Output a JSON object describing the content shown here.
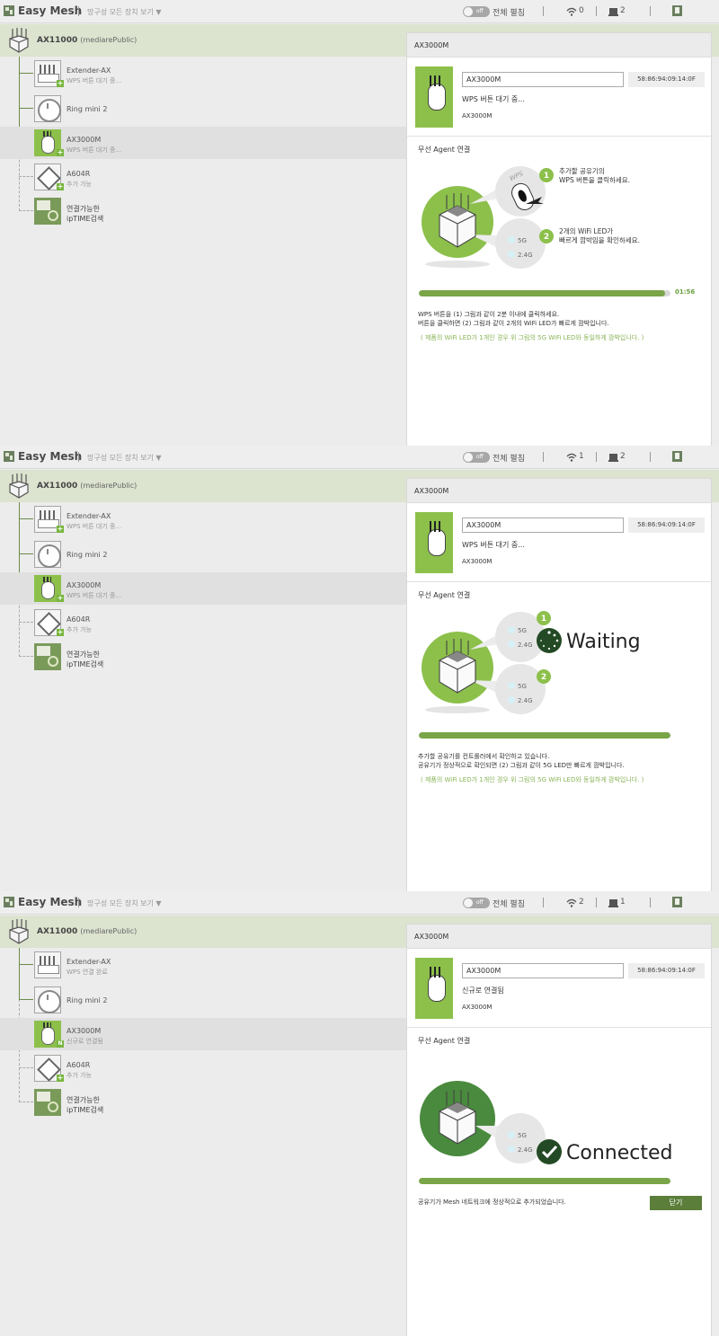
{
  "colors": {
    "accent": "#7aa548",
    "accent_dark": "#4a8a3e",
    "root_row_bg": "#dce3cf",
    "note_text": "#8ab357"
  },
  "panels": [
    {
      "app_title": "Easy Mesh",
      "view_all": "망구성 모든 장치 보기 ▼",
      "toggle_text": "off",
      "expand_all": "전체 펼침",
      "wifi_count": "0",
      "wired_count": "2",
      "root_name": "AX11000",
      "root_sub": "(mediarePublic)",
      "nodes": [
        {
          "name": "Extender-AX",
          "status": "WPS 버튼 대기 중...",
          "badge": "+"
        },
        {
          "name": "Ring mini 2",
          "status": "",
          "badge": ""
        },
        {
          "name": "AX3000M",
          "status": "WPS 버튼 대기 중...",
          "badge": "+"
        },
        {
          "name": "A604R",
          "status": "추가 가능",
          "badge": "+"
        },
        {
          "name": "연결가능한",
          "status": "ipTIME검색",
          "badge": ""
        }
      ],
      "detail": {
        "header": "AX3000M",
        "name_value": "AX3000M",
        "mac": "58:86:94:09:14:0F",
        "status": "WPS 버튼 대기 중...",
        "model": "AX3000M",
        "section_title": "무선 Agent 연결",
        "step1_num": "1",
        "step1_line1": "추가할 공유기의",
        "step1_line2": "WPS 버튼을 클릭하세요.",
        "step2_num": "2",
        "step2_line1": "2개의 WiFi LED가",
        "step2_line2": "빠르게 깜박임을 확인하세요.",
        "wps_label": "WPS",
        "led_5g": "5G",
        "led_24g": "2.4G",
        "progress_percent": 98,
        "timer": "01:56",
        "desc_line1": "WPS 버튼을 (1) 그림과 같이 2분 이내에 클릭하세요.",
        "desc_line2": "버튼을 클릭하면 (2) 그림과 같이 2개의 WiFi LED가 빠르게 깜박입니다.",
        "note": "( 제품의 WiFi LED가 1개인 경우 위 그림의 5G WiFi LED와 동일하게 깜박입니다. )"
      }
    },
    {
      "app_title": "Easy Mesh",
      "view_all": "망구성 모든 장치 보기 ▼",
      "toggle_text": "off",
      "expand_all": "전체 펼침",
      "wifi_count": "1",
      "wired_count": "2",
      "root_name": "AX11000",
      "root_sub": "(mediarePublic)",
      "nodes": [
        {
          "name": "Extender-AX",
          "status": "WPS 버튼 대기 중...",
          "badge": "+"
        },
        {
          "name": "Ring mini 2",
          "status": "",
          "badge": ""
        },
        {
          "name": "AX3000M",
          "status": "WPS 버튼 대기 중...",
          "badge": "+"
        },
        {
          "name": "A604R",
          "status": "추가 가능",
          "badge": "+"
        },
        {
          "name": "연결가능한",
          "status": "ipTIME검색",
          "badge": ""
        }
      ],
      "detail": {
        "header": "AX3000M",
        "name_value": "AX3000M",
        "mac": "58:86:94:09:14:0F",
        "status": "WPS 버튼 대기 중...",
        "model": "AX3000M",
        "section_title": "무선 Agent 연결",
        "step1_num": "1",
        "step2_num": "2",
        "led_5g": "5G",
        "led_24g": "2.4G",
        "waiting": "Waiting",
        "progress_percent": 100,
        "desc_line1": "추가할 공유기를 컨트롤러에서 확인하고 있습니다.",
        "desc_line2": "공유기가 정상적으로 확인되면 (2) 그림과 같이 5G LED만 빠르게 깜박입니다.",
        "note": "( 제품의 WiFi LED가 1개인 경우 위 그림의 5G WiFi LED와 동일하게 깜박입니다. )"
      }
    },
    {
      "app_title": "Easy Mesh",
      "view_all": "망구성 모든 장치 보기 ▼",
      "toggle_text": "off",
      "expand_all": "전체 펼침",
      "wifi_count": "2",
      "wired_count": "1",
      "root_name": "AX11000",
      "root_sub": "(mediarePublic)",
      "nodes": [
        {
          "name": "Extender-AX",
          "status": "WPS 연결 완료",
          "badge": ""
        },
        {
          "name": "Ring mini 2",
          "status": "",
          "badge": ""
        },
        {
          "name": "AX3000M",
          "status": "신규로 연결됨",
          "badge": "N"
        },
        {
          "name": "A604R",
          "status": "추가 가능",
          "badge": "+"
        },
        {
          "name": "연결가능한",
          "status": "ipTIME검색",
          "badge": ""
        }
      ],
      "detail": {
        "header": "AX3000M",
        "name_value": "AX3000M",
        "mac": "58:86:94:09:14:0F",
        "status": "신규로 연결됨",
        "model": "AX3000M",
        "section_title": "무선 Agent 연결",
        "led_5g": "5G",
        "led_24g": "2.4G",
        "connected": "Connected",
        "progress_percent": 100,
        "desc_line1": "공유기가 Mesh 네트워크에 정상적으로 추가되었습니다.",
        "close_label": "닫기"
      }
    }
  ]
}
